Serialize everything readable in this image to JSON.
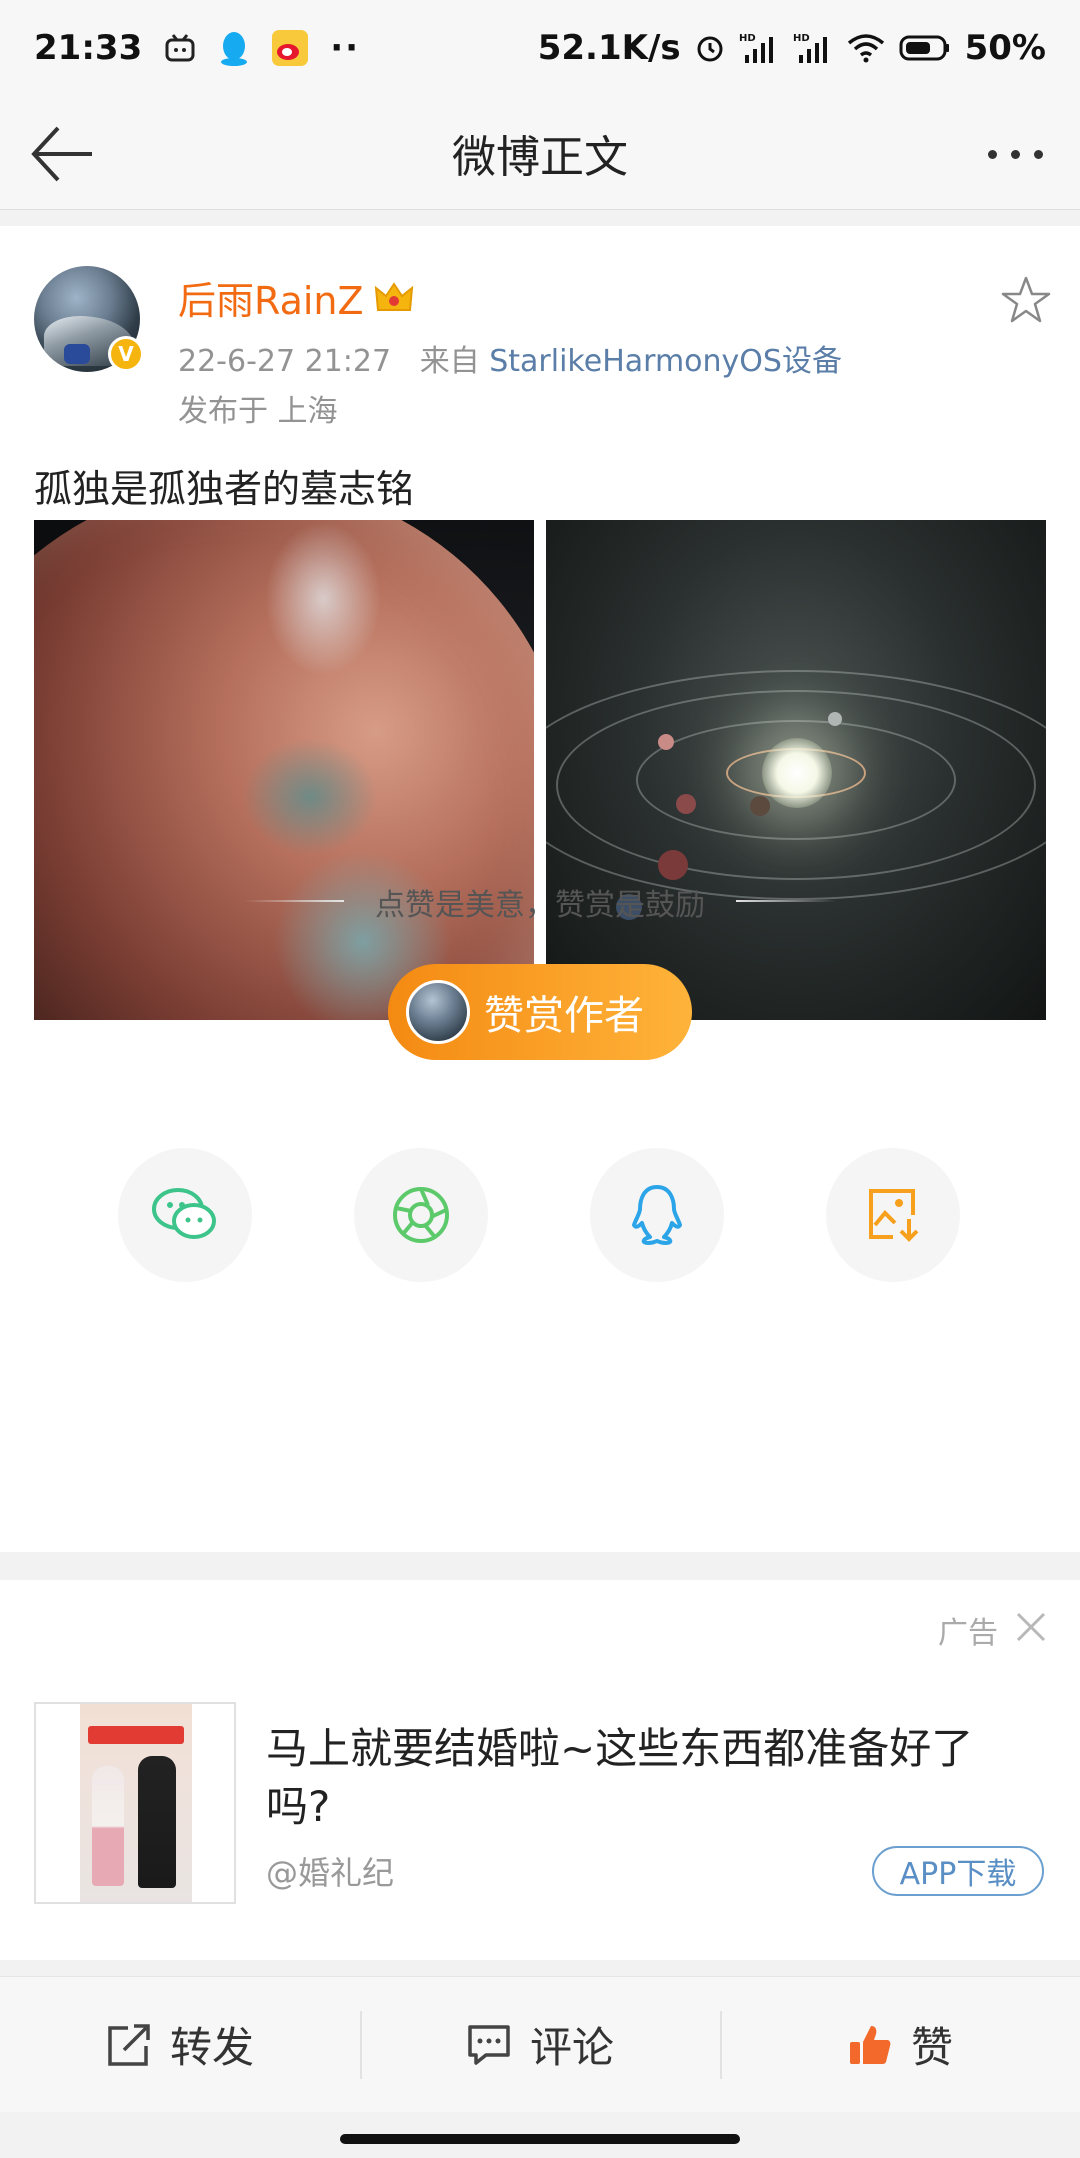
{
  "status_bar": {
    "time": "21:33",
    "network_speed": "52.1K/s",
    "battery": "50%"
  },
  "nav": {
    "title": "微博正文"
  },
  "post": {
    "username": "后雨RainZ",
    "date": "22-6-27 21:27",
    "from_label": "来自",
    "source": "StarlikeHarmonyOS设备",
    "location": "发布于 上海",
    "text": "孤独是孤独者的墓志铭",
    "verified_badge": "V"
  },
  "reward": {
    "tagline": "点赞是美意，赞赏是鼓励",
    "button_label": "赞赏作者"
  },
  "share": {
    "icons": [
      "wechat-icon",
      "moments-icon",
      "qq-icon",
      "save-image-icon"
    ]
  },
  "ad": {
    "label": "广告",
    "title": "马上就要结婚啦~这些东西都准备好了吗?",
    "source": "@婚礼纪",
    "button": "APP下载"
  },
  "bottom_bar": {
    "repost": "转发",
    "comment": "评论",
    "like": "赞"
  },
  "colors": {
    "username": "#f26b12",
    "source_link": "#5a7ea8",
    "reward_gradient_start": "#f48a12",
    "reward_gradient_end": "#ffb33a",
    "like_icon": "#f2692b"
  }
}
